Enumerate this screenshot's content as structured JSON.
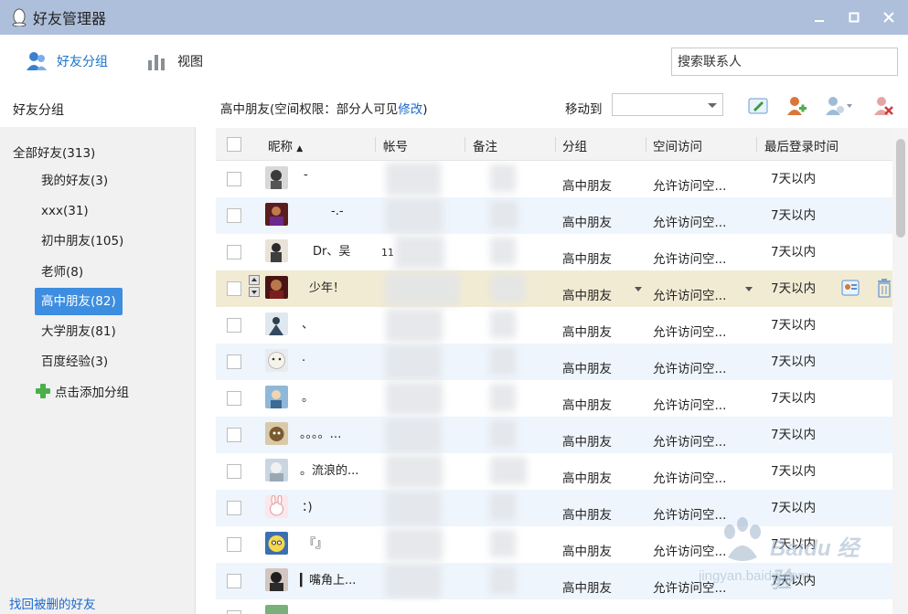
{
  "window": {
    "title": "好友管理器"
  },
  "toolbar": {
    "friends_label": "好友分组",
    "view_label": "视图"
  },
  "search": {
    "placeholder": "搜索联系人"
  },
  "sidebar": {
    "heading": "好友分组",
    "all_label": "全部好友(313)",
    "items": [
      {
        "label": "我的好友(3)"
      },
      {
        "label": "xxx(31)"
      },
      {
        "label": "初中朋友(105)"
      },
      {
        "label": "老师(8)"
      },
      {
        "label": "高中朋友(82)",
        "active": true
      },
      {
        "label": "大学朋友(81)"
      },
      {
        "label": "百度经验(3)"
      }
    ],
    "add_label": "点击添加分组",
    "recover_label": "找回被删的好友"
  },
  "group_header": {
    "prefix": "高中朋友(空间权限：部分人可见",
    "modify": "修改",
    "suffix": ")"
  },
  "moveto": {
    "label": "移动到",
    "value": ""
  },
  "table": {
    "columns": {
      "nick": "昵称",
      "account": "帐号",
      "remark": "备注",
      "group": "分组",
      "access": "空间访问",
      "last_login": "最后登录时间"
    },
    "rows": [
      {
        "nick": "-",
        "group": "高中朋友",
        "access": "允许访问空...",
        "last_login": "7天以内"
      },
      {
        "nick": "-.-",
        "group": "高中朋友",
        "access": "允许访问空...",
        "last_login": "7天以内"
      },
      {
        "nick": "Dr、吴",
        "account": "11",
        "group": "高中朋友",
        "access": "允许访问空...",
        "last_login": "7天以内"
      },
      {
        "nick": "少年！",
        "group": "高中朋友",
        "access": "允许访问空...",
        "last_login": "7天以内"
      },
      {
        "nick": "、",
        "group": "高中朋友",
        "access": "允许访问空...",
        "last_login": "7天以内"
      },
      {
        "nick": ".",
        "group": "高中朋友",
        "access": "允许访问空...",
        "last_login": "7天以内"
      },
      {
        "nick": "。",
        "group": "高中朋友",
        "access": "允许访问空...",
        "last_login": "7天以内"
      },
      {
        "nick": "。。。。…",
        "group": "高中朋友",
        "access": "允许访问空...",
        "last_login": "7天以内"
      },
      {
        "nick": "。流浪的...",
        "group": "高中朋友",
        "access": "允许访问空...",
        "last_login": "7天以内"
      },
      {
        "nick": "：)",
        "group": "高中朋友",
        "access": "允许访问空...",
        "last_login": "7天以内"
      },
      {
        "nick": "『』",
        "group": "高中朋友",
        "access": "允许访问空...",
        "last_login": "7天以内"
      },
      {
        "nick": "▎嘴角上...",
        "group": "高中朋友",
        "access": "允许访问空...",
        "last_login": "7天以内"
      }
    ]
  },
  "watermark": {
    "text": "Baidu 经验",
    "sub": "jingyan.baidu.com"
  },
  "colors": {
    "titlebar": "#aebfdb",
    "accent": "#3d8ee0",
    "link": "#1a6ad0",
    "selected_row": "#f2ebd4",
    "alt_row": "#eef5fc"
  }
}
